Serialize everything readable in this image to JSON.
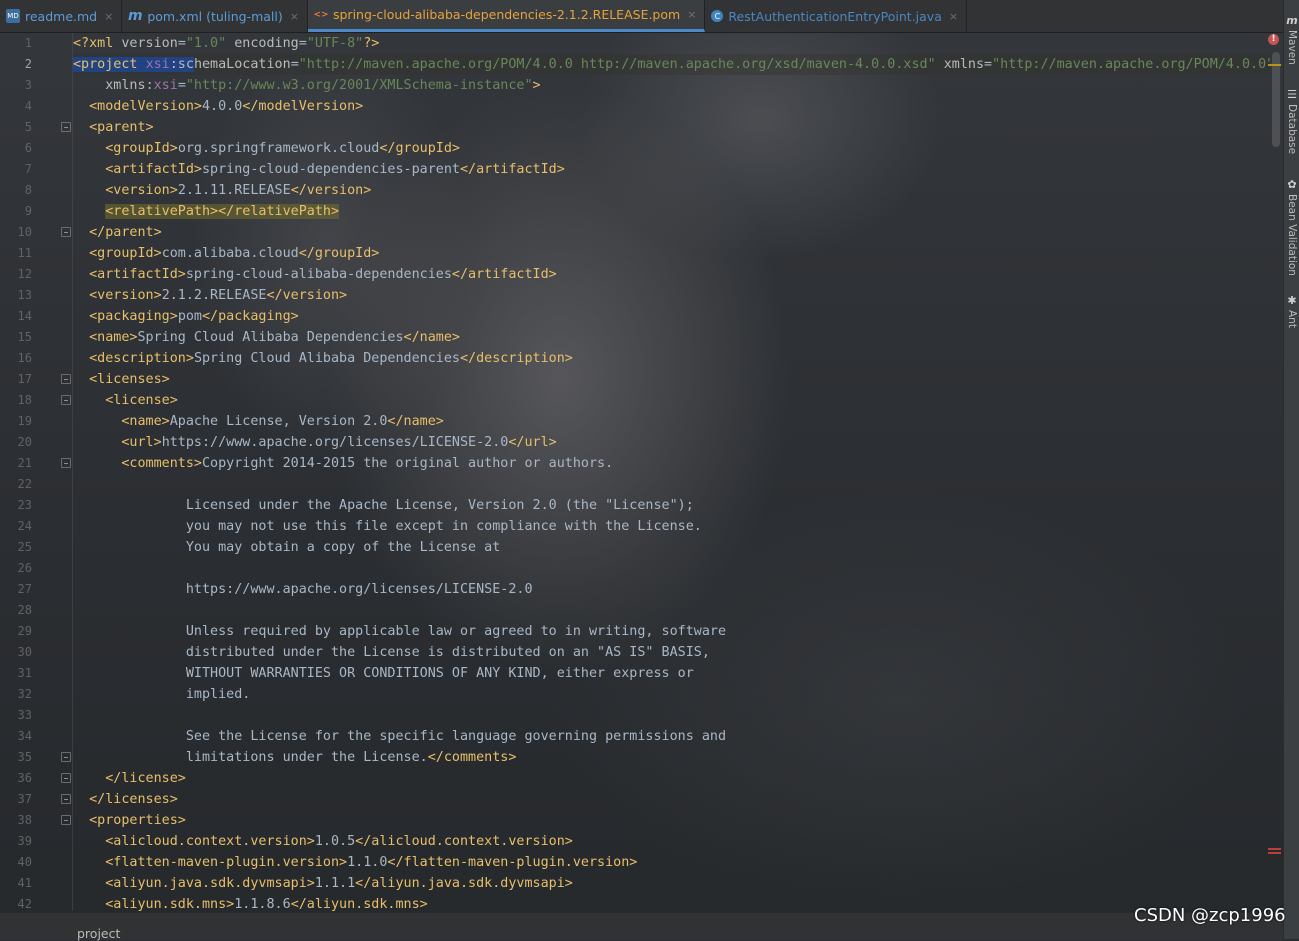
{
  "tabs": [
    {
      "label": "readme.md",
      "icon": "markdown-file-icon",
      "icon_glyph": "MD",
      "active": false
    },
    {
      "label": "pom.xml (tuling-mall)",
      "icon": "maven-file-icon",
      "icon_glyph": "m",
      "active": false
    },
    {
      "label": "spring-cloud-alibaba-dependencies-2.1.2.RELEASE.pom",
      "icon": "pom-file-icon",
      "icon_glyph": "<>",
      "active": true
    },
    {
      "label": "RestAuthenticationEntryPoint.java",
      "icon": "java-class-icon",
      "icon_glyph": "C",
      "active": false
    }
  ],
  "tab_close_glyph": "×",
  "right_tools": [
    {
      "label": "Maven",
      "icon": "maven-icon",
      "glyph": "m"
    },
    {
      "label": "Database",
      "icon": "database-icon",
      "glyph": "☰"
    },
    {
      "label": "Bean Validation",
      "icon": "bean-validation-icon",
      "glyph": "✿"
    },
    {
      "label": "Ant",
      "icon": "ant-icon",
      "glyph": "✱"
    }
  ],
  "editor": {
    "current_line": 2,
    "lines": [
      {
        "n": 1,
        "fold": false,
        "segs": [
          [
            "pi",
            "<?xml "
          ],
          [
            "attr",
            "version"
          ],
          [
            "txt",
            "="
          ],
          [
            "val",
            "\"1.0\""
          ],
          [
            "attr",
            " encoding"
          ],
          [
            "txt",
            "="
          ],
          [
            "val",
            "\"UTF-8\""
          ],
          [
            "pi",
            "?>"
          ]
        ]
      },
      {
        "n": 2,
        "fold": false,
        "segs": [
          [
            "tag sel",
            "<project "
          ],
          [
            "ns sel",
            "xsi"
          ],
          [
            "attr sel",
            ":sc"
          ],
          [
            "attr",
            "hemaLocation"
          ],
          [
            "txt",
            "="
          ],
          [
            "val",
            "\"http://maven.apache.org/POM/4.0.0 http://maven.apache.org/xsd/maven-4.0.0.xsd\""
          ],
          [
            "attr",
            " xmlns"
          ],
          [
            "txt",
            "="
          ],
          [
            "val",
            "\"http://maven.apache.org/POM/4.0.0\""
          ]
        ]
      },
      {
        "n": 3,
        "fold": false,
        "segs": [
          [
            "attr",
            "    xmlns"
          ],
          [
            "txt",
            ":"
          ],
          [
            "ns",
            "xsi"
          ],
          [
            "txt",
            "="
          ],
          [
            "val",
            "\"http://www.w3.org/2001/XMLSchema-instance\""
          ],
          [
            "tag",
            ">"
          ]
        ]
      },
      {
        "n": 4,
        "fold": false,
        "segs": [
          [
            "tag",
            "  <modelVersion>"
          ],
          [
            "txt",
            "4.0.0"
          ],
          [
            "tag",
            "</modelVersion>"
          ]
        ]
      },
      {
        "n": 5,
        "fold": true,
        "segs": [
          [
            "tag",
            "  <parent>"
          ]
        ]
      },
      {
        "n": 6,
        "fold": false,
        "segs": [
          [
            "tag",
            "    <groupId>"
          ],
          [
            "txt",
            "org.springframework.cloud"
          ],
          [
            "tag",
            "</groupId>"
          ]
        ]
      },
      {
        "n": 7,
        "fold": false,
        "segs": [
          [
            "tag",
            "    <artifactId>"
          ],
          [
            "txt",
            "spring-cloud-dependencies-parent"
          ],
          [
            "tag",
            "</artifactId>"
          ]
        ]
      },
      {
        "n": 8,
        "fold": false,
        "segs": [
          [
            "tag",
            "    <version>"
          ],
          [
            "txt",
            "2.1.11.RELEASE"
          ],
          [
            "tag",
            "</version>"
          ]
        ]
      },
      {
        "n": 9,
        "fold": false,
        "segs": [
          [
            "txt",
            "    "
          ],
          [
            "tag mark",
            "<relativePath></relativePath>"
          ]
        ]
      },
      {
        "n": 10,
        "fold": true,
        "segs": [
          [
            "tag",
            "  </parent>"
          ]
        ]
      },
      {
        "n": 11,
        "fold": false,
        "segs": [
          [
            "tag",
            "  <groupId>"
          ],
          [
            "txt",
            "com.alibaba.cloud"
          ],
          [
            "tag",
            "</groupId>"
          ]
        ]
      },
      {
        "n": 12,
        "fold": false,
        "segs": [
          [
            "tag",
            "  <artifactId>"
          ],
          [
            "txt",
            "spring-cloud-alibaba-dependencies"
          ],
          [
            "tag",
            "</artifactId>"
          ]
        ]
      },
      {
        "n": 13,
        "fold": false,
        "segs": [
          [
            "tag",
            "  <version>"
          ],
          [
            "txt",
            "2.1.2.RELEASE"
          ],
          [
            "tag",
            "</version>"
          ]
        ]
      },
      {
        "n": 14,
        "fold": false,
        "segs": [
          [
            "tag",
            "  <packaging>"
          ],
          [
            "txt",
            "pom"
          ],
          [
            "tag",
            "</packaging>"
          ]
        ]
      },
      {
        "n": 15,
        "fold": false,
        "segs": [
          [
            "tag",
            "  <name>"
          ],
          [
            "txt",
            "Spring Cloud Alibaba Dependencies"
          ],
          [
            "tag",
            "</name>"
          ]
        ]
      },
      {
        "n": 16,
        "fold": false,
        "segs": [
          [
            "tag",
            "  <description>"
          ],
          [
            "txt",
            "Spring Cloud Alibaba Dependencies"
          ],
          [
            "tag",
            "</description>"
          ]
        ]
      },
      {
        "n": 17,
        "fold": true,
        "segs": [
          [
            "tag",
            "  <licenses>"
          ]
        ]
      },
      {
        "n": 18,
        "fold": true,
        "segs": [
          [
            "tag",
            "    <license>"
          ]
        ]
      },
      {
        "n": 19,
        "fold": false,
        "segs": [
          [
            "tag",
            "      <name>"
          ],
          [
            "txt",
            "Apache License, Version 2.0"
          ],
          [
            "tag",
            "</name>"
          ]
        ]
      },
      {
        "n": 20,
        "fold": false,
        "segs": [
          [
            "tag",
            "      <url>"
          ],
          [
            "txt",
            "https://www.apache.org/licenses/LICENSE-2.0"
          ],
          [
            "tag",
            "</url>"
          ]
        ]
      },
      {
        "n": 21,
        "fold": true,
        "segs": [
          [
            "tag",
            "      <comments>"
          ],
          [
            "txt",
            "Copyright 2014-2015 the original author or authors."
          ]
        ]
      },
      {
        "n": 22,
        "fold": false,
        "segs": []
      },
      {
        "n": 23,
        "fold": false,
        "segs": [
          [
            "txt",
            "              Licensed under the Apache License, Version 2.0 (the \"License\");"
          ]
        ]
      },
      {
        "n": 24,
        "fold": false,
        "segs": [
          [
            "txt",
            "              you may not use this file except in compliance with the License."
          ]
        ]
      },
      {
        "n": 25,
        "fold": false,
        "segs": [
          [
            "txt",
            "              You may obtain a copy of the License at"
          ]
        ]
      },
      {
        "n": 26,
        "fold": false,
        "segs": []
      },
      {
        "n": 27,
        "fold": false,
        "segs": [
          [
            "txt",
            "              https://www.apache.org/licenses/LICENSE-2.0"
          ]
        ]
      },
      {
        "n": 28,
        "fold": false,
        "segs": []
      },
      {
        "n": 29,
        "fold": false,
        "segs": [
          [
            "txt",
            "              Unless required by applicable law or agreed to in writing, software"
          ]
        ]
      },
      {
        "n": 30,
        "fold": false,
        "segs": [
          [
            "txt",
            "              distributed under the License is distributed on an \"AS IS\" BASIS,"
          ]
        ]
      },
      {
        "n": 31,
        "fold": false,
        "segs": [
          [
            "txt",
            "              WITHOUT WARRANTIES OR CONDITIONS OF ANY KIND, either express or"
          ]
        ]
      },
      {
        "n": 32,
        "fold": false,
        "segs": [
          [
            "txt",
            "              implied."
          ]
        ]
      },
      {
        "n": 33,
        "fold": false,
        "segs": []
      },
      {
        "n": 34,
        "fold": false,
        "segs": [
          [
            "txt",
            "              See the License for the specific language governing permissions and"
          ]
        ]
      },
      {
        "n": 35,
        "fold": true,
        "segs": [
          [
            "txt",
            "              limitations under the License."
          ],
          [
            "tag",
            "</comments>"
          ]
        ]
      },
      {
        "n": 36,
        "fold": true,
        "segs": [
          [
            "tag",
            "    </license>"
          ]
        ]
      },
      {
        "n": 37,
        "fold": true,
        "segs": [
          [
            "tag",
            "  </licenses>"
          ]
        ]
      },
      {
        "n": 38,
        "fold": true,
        "segs": [
          [
            "tag",
            "  <properties>"
          ]
        ]
      },
      {
        "n": 39,
        "fold": false,
        "segs": [
          [
            "tag",
            "    <alicloud.context.version>"
          ],
          [
            "txt",
            "1.0.5"
          ],
          [
            "tag",
            "</alicloud.context.version>"
          ]
        ]
      },
      {
        "n": 40,
        "fold": false,
        "segs": [
          [
            "tag",
            "    <flatten-maven-plugin.version>"
          ],
          [
            "txt",
            "1.1.0"
          ],
          [
            "tag",
            "</flatten-maven-plugin.version>"
          ]
        ]
      },
      {
        "n": 41,
        "fold": false,
        "segs": [
          [
            "tag",
            "    <aliyun.java.sdk.dyvmsapi>"
          ],
          [
            "txt",
            "1.1.1"
          ],
          [
            "tag",
            "</aliyun.java.sdk.dyvmsapi>"
          ]
        ]
      },
      {
        "n": 42,
        "fold": false,
        "segs": [
          [
            "tag",
            "    <aliyun.sdk.mns>"
          ],
          [
            "txt",
            "1.1.8.6"
          ],
          [
            "tag",
            "</aliyun.sdk.mns>"
          ]
        ]
      }
    ]
  },
  "status": {
    "warning_glyph": "!"
  },
  "breadcrumb": {
    "path": "project"
  },
  "watermark": "CSDN @zcp1996"
}
